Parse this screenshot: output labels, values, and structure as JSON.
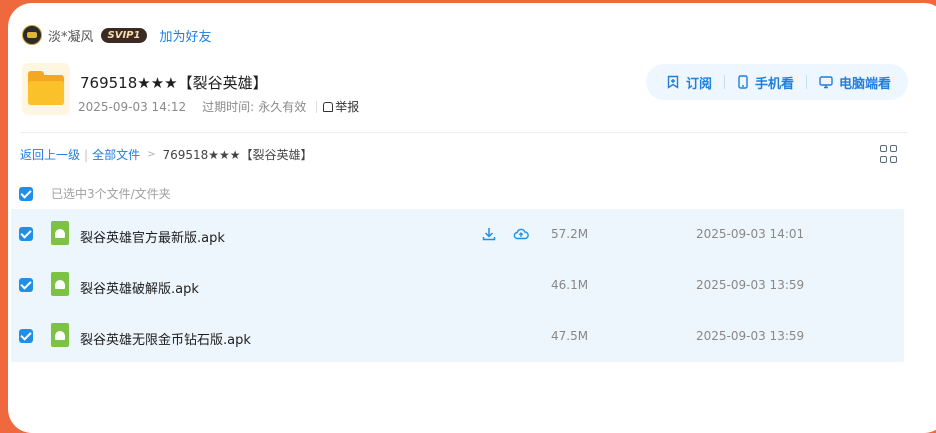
{
  "user": {
    "name": "淡*凝风",
    "vip_badge": "SVIP1",
    "add_friend": "加为好友"
  },
  "share": {
    "title": "769518★★★【裂谷英雄】",
    "date": "2025-09-03 14:12",
    "expiry_label": "过期时间:",
    "expiry_value": "永久有效",
    "report": "举报"
  },
  "actions": [
    {
      "label": "订阅",
      "icon": "bookmark-plus-icon"
    },
    {
      "label": "手机看",
      "icon": "phone-icon"
    },
    {
      "label": "电脑端看",
      "icon": "monitor-icon"
    }
  ],
  "breadcrumb": {
    "back": "返回上一级",
    "all_files": "全部文件",
    "current": "769518★★★【裂谷英雄】"
  },
  "selection_text": "已选中3个文件/文件夹",
  "files": [
    {
      "name": "裂谷英雄官方最新版.apk",
      "size": "57.2M",
      "date": "2025-09-03 14:01",
      "checked": true
    },
    {
      "name": "裂谷英雄破解版.apk",
      "size": "46.1M",
      "date": "2025-09-03 13:59",
      "checked": true
    },
    {
      "name": "裂谷英雄无限金币钻石版.apk",
      "size": "47.5M",
      "date": "2025-09-03 13:59",
      "checked": true
    }
  ],
  "colors": {
    "accent": "#1f7fdc",
    "background": "#f0683e",
    "row_selected": "#eef6fd",
    "apk_green": "#7cc243"
  }
}
